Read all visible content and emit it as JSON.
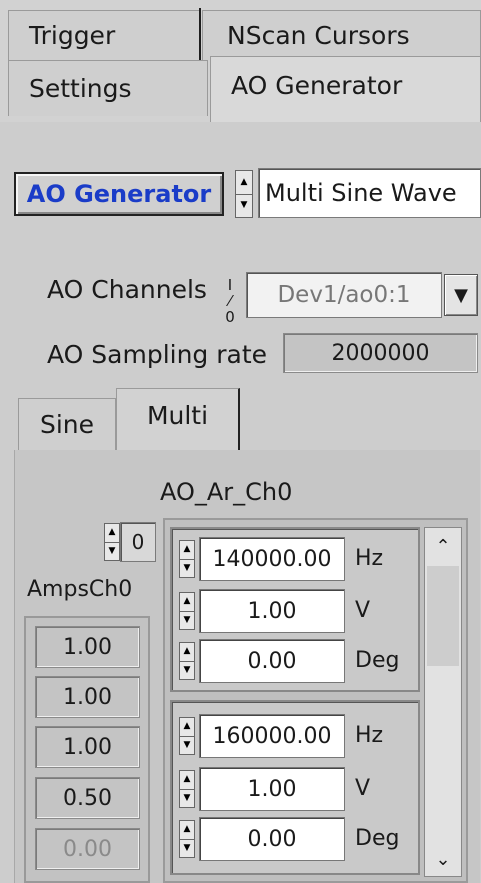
{
  "tabs_top": [
    "Trigger",
    "NScan Cursors"
  ],
  "tabs_bottom": [
    "Settings",
    "AO Generator"
  ],
  "ao_generator_button": "AO Generator",
  "waveform_select": "Multi Sine Wave",
  "ao_channels": {
    "label": "AO Channels",
    "io_icon": "I/O",
    "value": "Dev1/ao0:1"
  },
  "ao_sampling_rate": {
    "label": "AO Sampling rate",
    "value": "2000000"
  },
  "subtabs": [
    "Sine",
    "Multi"
  ],
  "array_title": "AO_Ar_Ch0",
  "array_index": "0",
  "amps_label": "AmpsCh0",
  "amps": [
    "1.00",
    "1.00",
    "1.00",
    "0.50",
    "0.00"
  ],
  "clusters": [
    {
      "freq": "140000.00",
      "freq_unit": "Hz",
      "amp": "1.00",
      "amp_unit": "V",
      "phase": "0.00",
      "phase_unit": "Deg"
    },
    {
      "freq": "160000.00",
      "freq_unit": "Hz",
      "amp": "1.00",
      "amp_unit": "V",
      "phase": "0.00",
      "phase_unit": "Deg"
    }
  ],
  "icons": {
    "spin": "spinner-arrows-icon",
    "dropdown": "dropdown-arrow-icon",
    "scroll_up": "scroll-up-icon",
    "scroll_down": "scroll-down-icon"
  }
}
